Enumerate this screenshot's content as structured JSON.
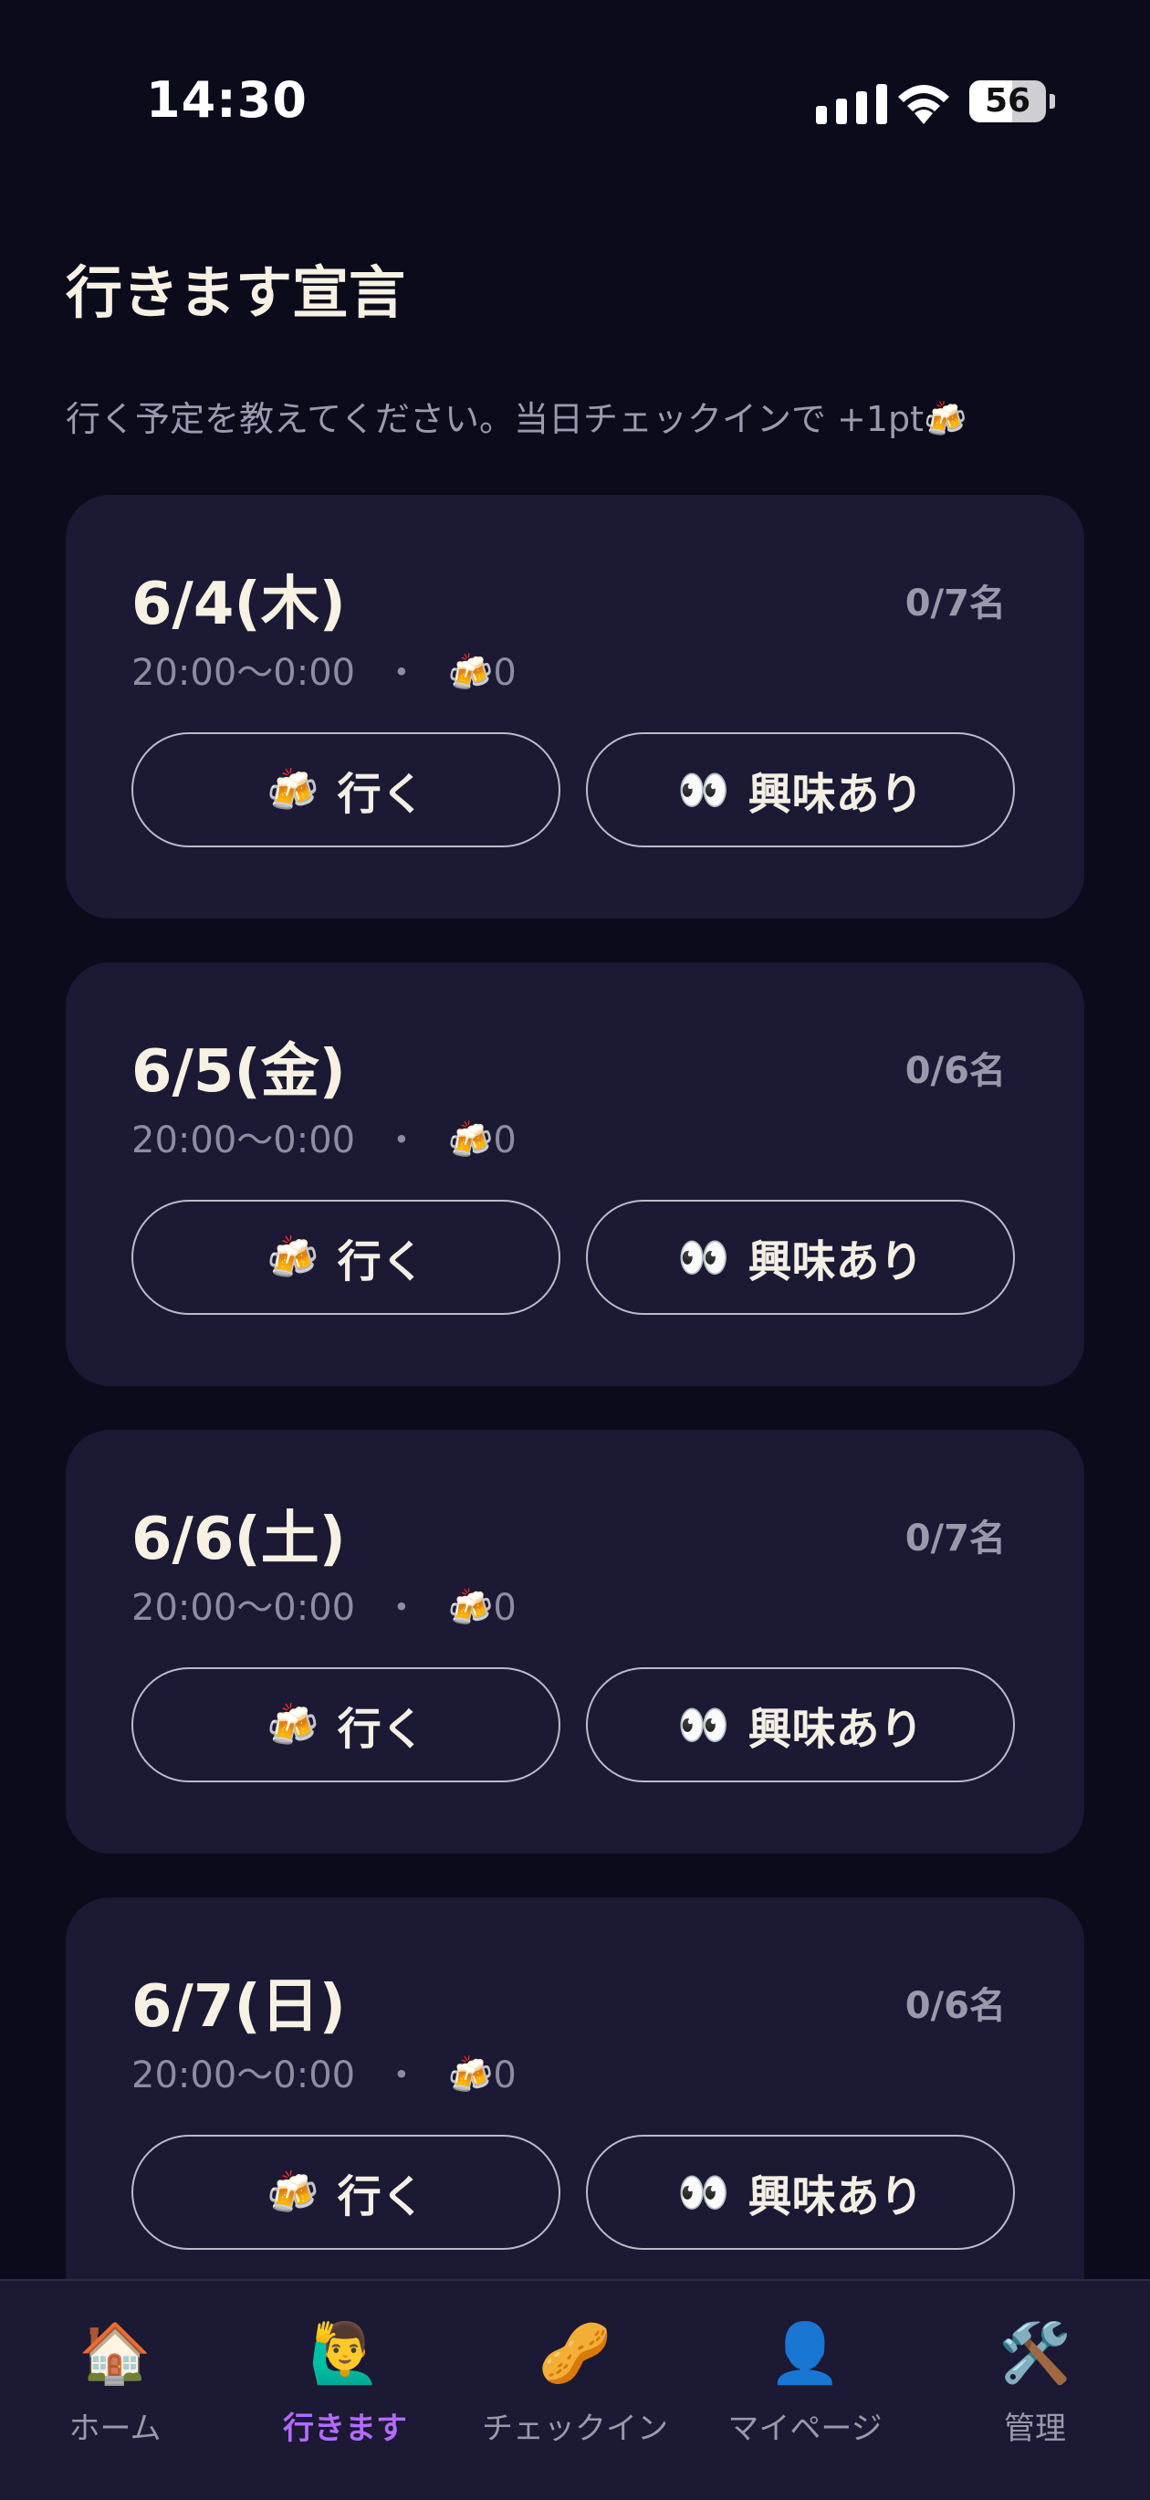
{
  "status_bar": {
    "time": "14:30",
    "battery": "56",
    "battery_level": 0.56
  },
  "header": {
    "title": "行きます宣言",
    "subtitle": "行く予定を教えてください。当日チェックインで +1pt🍻"
  },
  "events": [
    {
      "date": "6/4(木)",
      "count": "0/7名",
      "time": "20:00〜0:00",
      "separator": "・",
      "beer_icon": "🍻",
      "beer_count": "0",
      "go_label": "行く",
      "interest_icon": "👀",
      "interest_label": "興味あり"
    },
    {
      "date": "6/5(金)",
      "count": "0/6名",
      "time": "20:00〜0:00",
      "separator": "・",
      "beer_icon": "🍻",
      "beer_count": "0",
      "go_label": "行く",
      "interest_icon": "👀",
      "interest_label": "興味あり"
    },
    {
      "date": "6/6(土)",
      "count": "0/7名",
      "time": "20:00〜0:00",
      "separator": "・",
      "beer_icon": "🍻",
      "beer_count": "0",
      "go_label": "行く",
      "interest_icon": "👀",
      "interest_label": "興味あり"
    },
    {
      "date": "6/7(日)",
      "count": "0/6名",
      "time": "20:00〜0:00",
      "separator": "・",
      "beer_icon": "🍻",
      "beer_count": "0",
      "go_label": "行く",
      "interest_icon": "👀",
      "interest_label": "興味あり"
    }
  ],
  "tabs": [
    {
      "icon": "🏠",
      "label": "ホーム",
      "active": false
    },
    {
      "icon": "🙋‍♂️",
      "label": "行きます",
      "active": true
    },
    {
      "icon": "🥜",
      "label": "チェックイン",
      "active": false
    },
    {
      "icon": "👤",
      "label": "マイページ",
      "active": false
    },
    {
      "icon": "🛠️",
      "label": "管理",
      "active": false
    }
  ],
  "colors": {
    "background": "#0c0b1c",
    "card": "#1b1933",
    "accent": "#b36bff",
    "text": "#f4efe4",
    "muted": "#9a98ab"
  }
}
